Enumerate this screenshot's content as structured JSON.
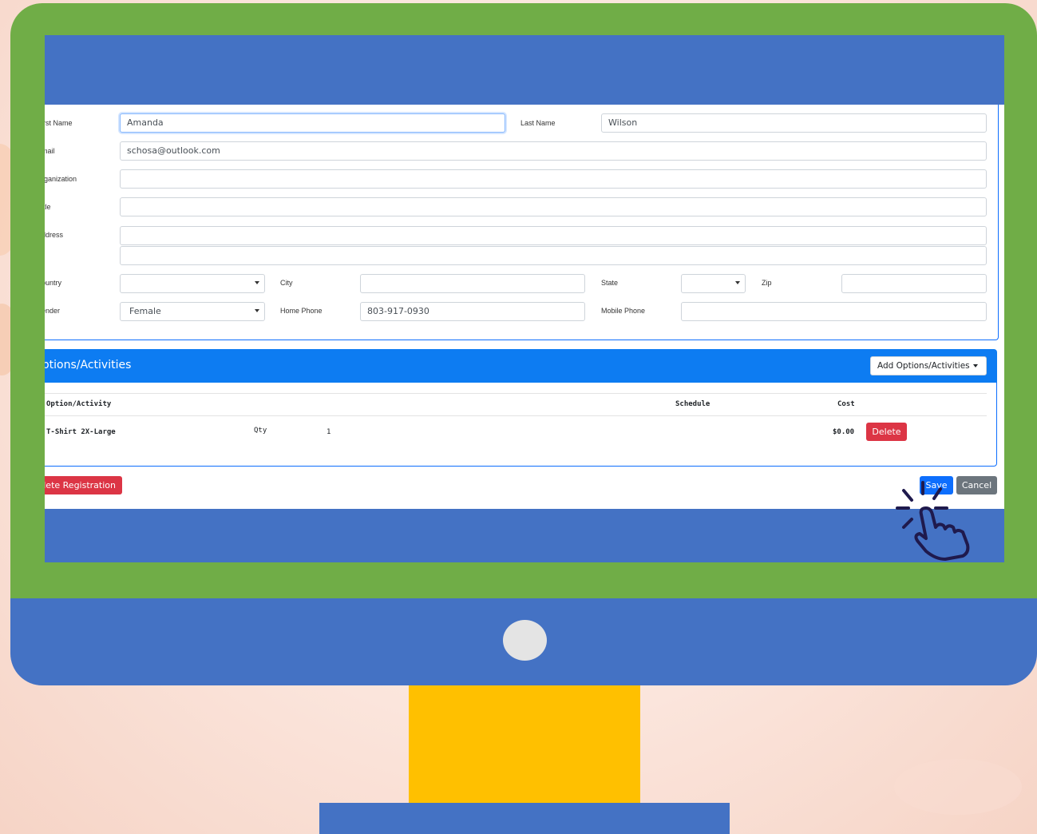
{
  "colors": {
    "frame": "#70ad47",
    "chin": "#4472c4",
    "stand_neck": "#ffc000",
    "stand_base": "#4472c4",
    "screen_bar": "#4472c4",
    "options_header": "#0d7cf2",
    "danger": "#dc3545",
    "primary": "#0d6efd",
    "secondary": "#6c757d"
  },
  "form": {
    "first_name_label": "irst Name",
    "first_name_value": "Amanda",
    "last_name_label": "Last Name",
    "last_name_value": "Wilson",
    "email_label": "mail",
    "email_value": "schosa@outlook.com",
    "organization_label": "rganization",
    "organization_value": "",
    "title_label": "itle",
    "title_value": "",
    "address_label": "ddress",
    "address1_value": "",
    "address2_value": "",
    "country_label": "ountry",
    "country_value": "",
    "city_label": "City",
    "city_value": "",
    "state_label": "State",
    "state_value": "",
    "zip_label": "Zip",
    "zip_value": "",
    "gender_label": "ender",
    "gender_value": "Female",
    "home_phone_label": "Home Phone",
    "home_phone_value": "803-917-0930",
    "mobile_phone_label": "Mobile Phone",
    "mobile_phone_value": ""
  },
  "options": {
    "title": "Dptions/Activities",
    "add_button": "Add Options/Activities",
    "columns": {
      "activity": "Option/Activity",
      "schedule": "Schedule",
      "cost": "Cost"
    },
    "rows": [
      {
        "activity": "T-Shirt 2X-Large",
        "qty_label": "Qty",
        "qty": "1",
        "cost": "$0.00",
        "delete_label": "Delete"
      }
    ]
  },
  "actions": {
    "delete_registration": "elete Registration",
    "save": "Save",
    "cancel": "Cancel"
  },
  "icons": {
    "cursor": "hand-pointer-click-icon",
    "power": "power-button-icon"
  }
}
